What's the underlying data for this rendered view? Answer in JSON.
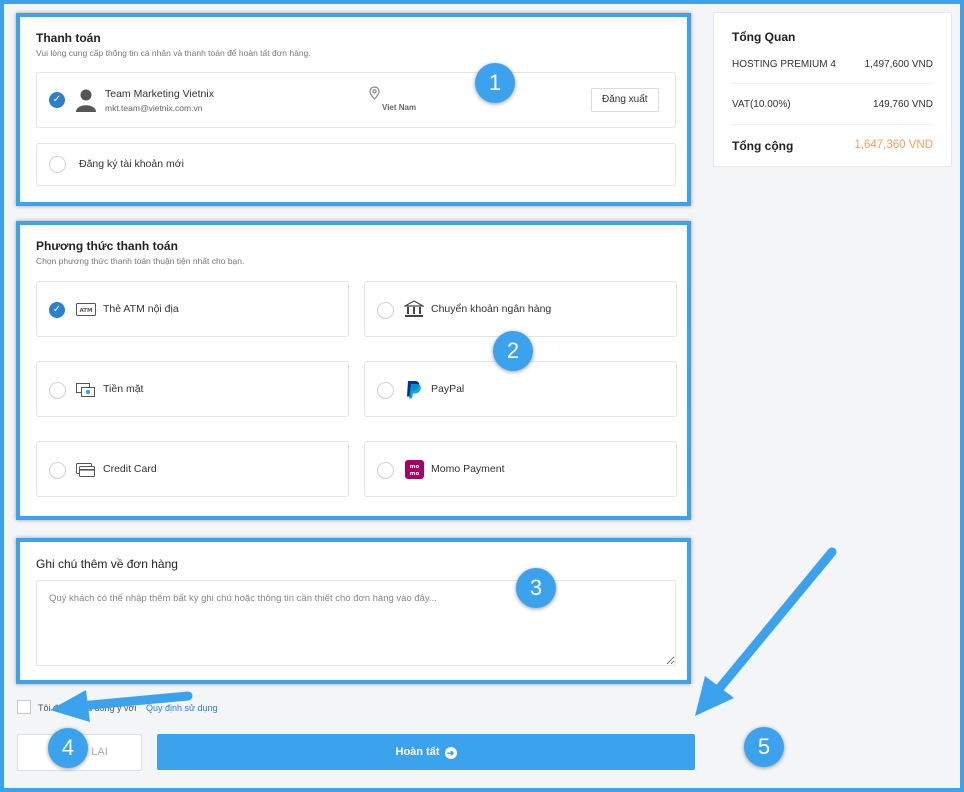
{
  "payment": {
    "title": "Thanh toán",
    "subtitle": "Vui lòng cung cấp thông tin cá nhân và thanh toán để hoàn tất đơn hàng.",
    "account": {
      "name": "Team Marketing Vietnix",
      "email": "mkt.team@vietnix.com.vn",
      "location": "Viet Nam",
      "logout_label": "Đăng xuất"
    },
    "new_account_label": "Đăng ký tài khoản mới"
  },
  "methods": {
    "title": "Phương thức thanh toán",
    "subtitle": "Chọn phương thức thanh toán thuận tiện nhất cho bạn.",
    "items": [
      {
        "label": "Thẻ ATM nội địa",
        "icon": "atm-card-icon",
        "selected": true
      },
      {
        "label": "Chuyển khoản ngân hàng",
        "icon": "bank-icon",
        "selected": false
      },
      {
        "label": "Tiền mặt",
        "icon": "cash-icon",
        "selected": false
      },
      {
        "label": "PayPal",
        "icon": "paypal-icon",
        "selected": false
      },
      {
        "label": "Credit Card",
        "icon": "credit-card-icon",
        "selected": false
      },
      {
        "label": "Momo Payment",
        "icon": "momo-icon",
        "selected": false
      }
    ]
  },
  "notes": {
    "title": "Ghi chú thêm về đơn hàng",
    "placeholder": "Quý khách có thể nhập thêm bất kỳ ghi chú hoặc thông tin cần thiết cho đơn hàng vào đây..."
  },
  "agree": {
    "text": "Tôi đã đọc và đồng ý với",
    "link": "Quy định sử dụng"
  },
  "buttons": {
    "back": "LẠI",
    "finish": "Hoàn tất"
  },
  "summary": {
    "title": "Tổng Quan",
    "rows": [
      {
        "label": "HOSTING PREMIUM 4",
        "value": "1,497,600 VND"
      },
      {
        "label": "VAT(10.00%)",
        "value": "149,760 VND"
      }
    ],
    "total_label": "Tổng cộng",
    "total_value": "1,647,360 VND"
  },
  "badges": [
    "1",
    "2",
    "3",
    "4",
    "5"
  ],
  "colors": {
    "accent": "#3ba2ee",
    "check": "#2a7fcf",
    "total": "#f0a05a",
    "momo": "#a50064",
    "paypal_dark": "#003087",
    "paypal_light": "#009cde"
  }
}
